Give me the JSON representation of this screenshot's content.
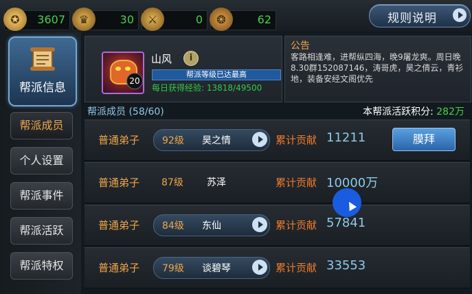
{
  "resources": [
    {
      "icon": "coin-icon",
      "value": "3607"
    },
    {
      "icon": "helmet-icon",
      "value": "30"
    },
    {
      "icon": "crossed-swords-icon",
      "value": "0"
    },
    {
      "icon": "shield-emblem-icon",
      "value": "62"
    }
  ],
  "rules_button": "规则说明",
  "sidebar": {
    "active": "帮派信息",
    "items": [
      "帮派成员",
      "个人设置",
      "帮派事件",
      "帮派活跃",
      "帮派特权"
    ]
  },
  "guild": {
    "leader_name": "山风",
    "level": "20",
    "level_status": "帮派等级已达最高",
    "exp_text": "每日获得经验: 13818/49500"
  },
  "notice": {
    "title": "公告",
    "text": "客路相逢难，进帮纵四海，晚9屠龙爽。周日晚8.30群152087146，涛哥虎，昊之倩云，青衫地，装备安经文阁优先"
  },
  "members": {
    "header": "帮派成员 (58/60)",
    "activity_label": "本帮派活跃积分:",
    "activity_value": "282万",
    "contrib_label": "累计贡献",
    "bow_label": "膜拜",
    "rows": [
      {
        "rank": "普通弟子",
        "level": "92级",
        "name": "昊之情",
        "contribution": "11211"
      },
      {
        "rank": "普通弟子",
        "level": "87级",
        "name": "苏泽",
        "contribution": "10000万"
      },
      {
        "rank": "普通弟子",
        "level": "84级",
        "name": "东仙",
        "contribution": "57841"
      },
      {
        "rank": "普通弟子",
        "level": "79级",
        "name": "谈碧琴",
        "contribution": "33553"
      }
    ]
  },
  "colors": {
    "accent": "#f0a64a",
    "green": "#47d24a",
    "blue": "#8ec9e8"
  }
}
